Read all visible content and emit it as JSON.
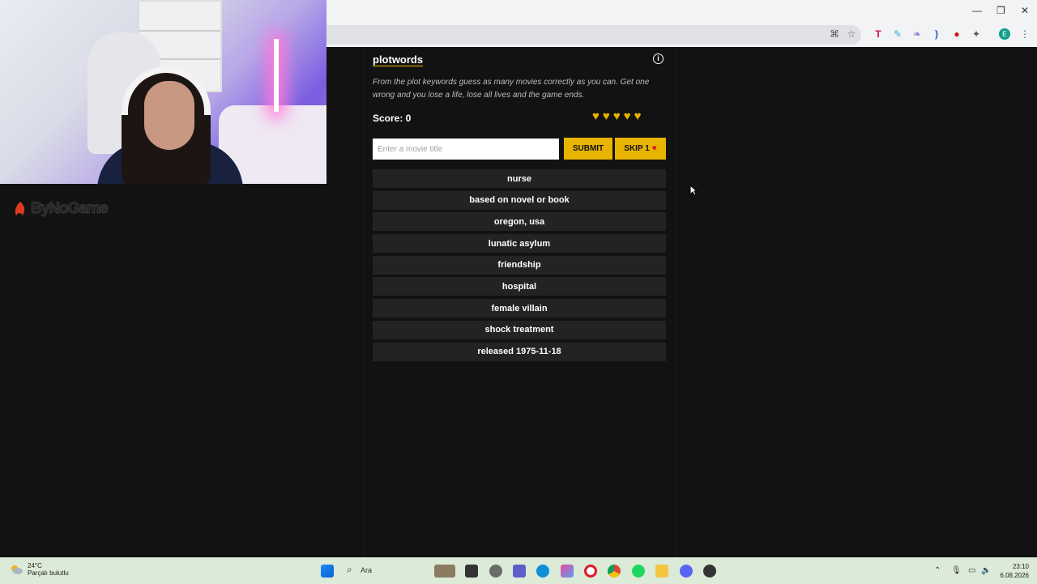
{
  "overlay": {
    "brand": "ByNoGame"
  },
  "game": {
    "title": "plotwords",
    "description": "From the plot keywords guess as many movies correctly as you can. Get one wrong and you lose a life, lose all lives and the game ends.",
    "score_label": "Score: 0",
    "lives": 5,
    "input_placeholder": "Enter a movie title",
    "submit_label": "SUBMIT",
    "skip_label": "SKIP 1",
    "keywords": [
      "nurse",
      "based on novel or book",
      "oregon, usa",
      "lunatic asylum",
      "friendship",
      "hospital",
      "female villain",
      "shock treatment",
      "released 1975-11-18"
    ]
  },
  "colors": {
    "accent": "#e8b400",
    "background": "#121212",
    "keyword_bg": "#232323",
    "skip_heart": "#c8102e"
  },
  "taskbar": {
    "weather_temp": "24°C",
    "weather_desc": "Parçalı bulutlu",
    "search_label": "Ara",
    "time": "23:10",
    "date": "6.08.2026"
  },
  "browser": {
    "profile_initial": "E"
  }
}
